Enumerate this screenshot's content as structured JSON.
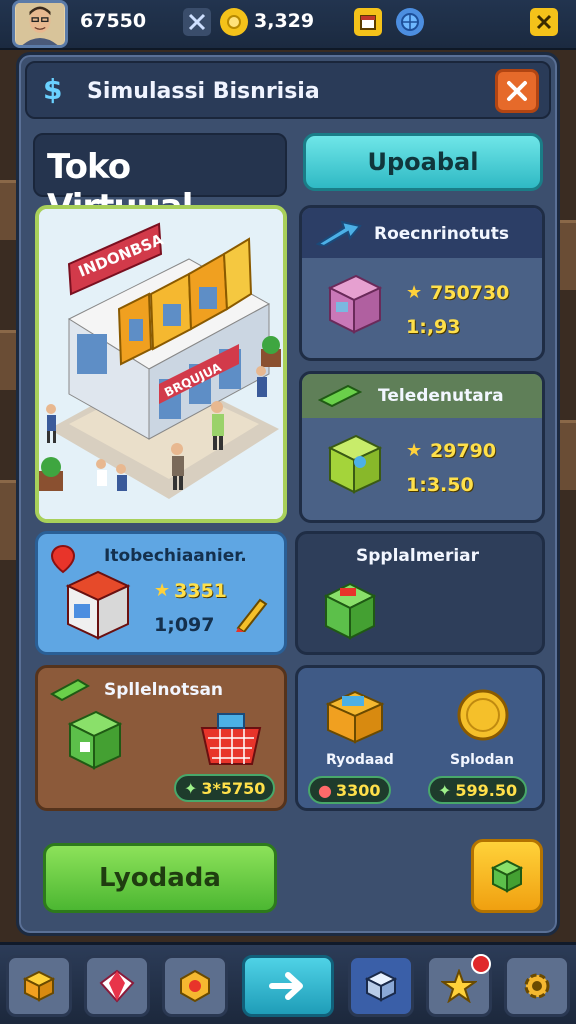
{
  "hud": {
    "coins": "67550",
    "gems": "3,329",
    "icons": [
      "avatar",
      "swords-icon",
      "coin-icon",
      "calendar-icon",
      "globe-icon",
      "tools-icon"
    ]
  },
  "panel": {
    "title_icon": "$",
    "title": "Simulassi Bisnrisia",
    "close_icon": "close-icon"
  },
  "store": {
    "name": "Toko Virtuual",
    "upgrade_label": "Upoabal",
    "sign_top": "INDONBSA",
    "sign_front": "BRQUJUA"
  },
  "cards": {
    "a": {
      "label": "Roecnrinotuts",
      "stat1": "750730",
      "stat2": "1:,93"
    },
    "b": {
      "label": "Teledenutara",
      "stat1": "29790",
      "stat2": "1:3.50"
    },
    "c": {
      "label": "Itobechiaanier.",
      "stat1": "3351",
      "stat2": "1;097"
    },
    "d": {
      "label": "Spplalmeriar"
    },
    "e": {
      "label": "Spllelnotsan",
      "pill": "3*5750"
    },
    "f": {
      "item1": "Ryodaad",
      "item2": "Splodan",
      "pill1": "3300",
      "pill2": "599.50"
    }
  },
  "actions": {
    "primary_label": "Lyodada",
    "side_icon": "cube-icon"
  },
  "bottom_nav": [
    "box-icon",
    "gem-icon",
    "hexagon-badge-icon",
    "arrow-right-icon",
    "cube-icon",
    "star-icon",
    "gear-icon"
  ],
  "colors": {
    "accent": "#2fb9c4",
    "primary": "#4cb732",
    "danger": "#e66a2a",
    "gold": "#ffe04a"
  }
}
